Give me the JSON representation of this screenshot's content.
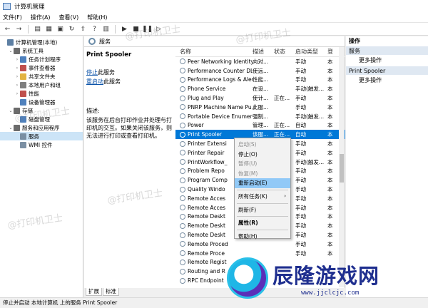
{
  "window": {
    "title": "计算机管理"
  },
  "menu": [
    "文件(F)",
    "操作(A)",
    "查看(V)",
    "帮助(H)"
  ],
  "toolbar_icons": [
    "back-arrow-icon",
    "forward-arrow-icon",
    "folder-up-icon",
    "console-tree-icon",
    "properties-icon",
    "refresh-icon",
    "export-icon",
    "help-icon",
    "show-hide-icon",
    "play-icon",
    "stop-icon",
    "pause-icon",
    "restart-icon"
  ],
  "tree": [
    {
      "label": "计算机管理(本地)",
      "level": 0,
      "tw": "",
      "icon": "#5d7fa3"
    },
    {
      "label": "系统工具",
      "level": 1,
      "tw": "⌄",
      "icon": "#6b6b6b"
    },
    {
      "label": "任务计划程序",
      "level": 2,
      "tw": "›",
      "icon": "#4f81bd"
    },
    {
      "label": "事件查看器",
      "level": 2,
      "tw": "›",
      "icon": "#c0504d"
    },
    {
      "label": "共享文件夹",
      "level": 2,
      "tw": "›",
      "icon": "#e3b341"
    },
    {
      "label": "本地用户和组",
      "level": 2,
      "tw": "›",
      "icon": "#7f7f7f"
    },
    {
      "label": "性能",
      "level": 2,
      "tw": "›",
      "icon": "#c0504d"
    },
    {
      "label": "设备管理器",
      "level": 2,
      "tw": "",
      "icon": "#4f81bd"
    },
    {
      "label": "存储",
      "level": 1,
      "tw": "⌄",
      "icon": "#6b6b6b"
    },
    {
      "label": "磁盘管理",
      "level": 2,
      "tw": "",
      "icon": "#4f81bd"
    },
    {
      "label": "服务和应用程序",
      "level": 1,
      "tw": "⌄",
      "icon": "#6b6b6b"
    },
    {
      "label": "服务",
      "level": 2,
      "tw": "",
      "icon": "#7a8fa3",
      "selected": true
    },
    {
      "label": "WMI 控件",
      "level": 2,
      "tw": "",
      "icon": "#7a8fa3"
    }
  ],
  "center": {
    "header": "服务",
    "service_name": "Print Spooler",
    "stop_link": "停止",
    "stop_suffix": "此服务",
    "restart_link": "重启动",
    "restart_suffix": "此服务",
    "desc_title": "描述:",
    "desc_text": "该服务在后台打印作业并处理与打印机的交互。如果关闭该服务，则无法进行打印或查看打印机。"
  },
  "columns": [
    "名称",
    "描述",
    "状态",
    "启动类型",
    "登"
  ],
  "services": [
    {
      "name": "Peer Networking Identity...",
      "desc": "向对...",
      "status": "",
      "start": "手动",
      "logon": "本"
    },
    {
      "name": "Performance Counter DL...",
      "desc": "使远...",
      "status": "",
      "start": "手动",
      "logon": "本"
    },
    {
      "name": "Performance Logs & Aler...",
      "desc": "性能...",
      "status": "",
      "start": "手动",
      "logon": "本"
    },
    {
      "name": "Phone Service",
      "desc": "在设...",
      "status": "",
      "start": "手动(触发...",
      "logon": "本"
    },
    {
      "name": "Plug and Play",
      "desc": "使计...",
      "status": "正在...",
      "start": "手动",
      "logon": "本"
    },
    {
      "name": "PNRP Machine Name Pu...",
      "desc": "此服...",
      "status": "",
      "start": "手动",
      "logon": "本"
    },
    {
      "name": "Portable Device Enumera...",
      "desc": "强制...",
      "status": "",
      "start": "手动(触发...",
      "logon": "本"
    },
    {
      "name": "Power",
      "desc": "管理...",
      "status": "正在...",
      "start": "自动",
      "logon": "本"
    },
    {
      "name": "Print Spooler",
      "desc": "该服...",
      "status": "正在...",
      "start": "自动",
      "logon": "本",
      "selected": true
    },
    {
      "name": "Printer Extensi",
      "desc": "",
      "status": "",
      "start": "手动",
      "logon": "本"
    },
    {
      "name": "Printer Repair",
      "desc": "",
      "status": "",
      "start": "手动",
      "logon": "本"
    },
    {
      "name": "PrintWorkflow_",
      "desc": "",
      "status": "",
      "start": "手动(触发...",
      "logon": "本"
    },
    {
      "name": "Problem Repo",
      "desc": "",
      "status": "",
      "start": "手动",
      "logon": "本"
    },
    {
      "name": "Program Comp",
      "desc": "",
      "status": "",
      "start": "手动",
      "logon": "本"
    },
    {
      "name": "Quality Windo",
      "desc": "",
      "status": "",
      "start": "手动",
      "logon": "本"
    },
    {
      "name": "Remote Acces",
      "desc": "",
      "status": "",
      "start": "手动",
      "logon": "本"
    },
    {
      "name": "Remote Acces",
      "desc": "",
      "status": "",
      "start": "手动",
      "logon": "本"
    },
    {
      "name": "Remote Deskt",
      "desc": "",
      "status": "",
      "start": "手动",
      "logon": "本"
    },
    {
      "name": "Remote Deskt",
      "desc": "",
      "status": "",
      "start": "手动",
      "logon": "本"
    },
    {
      "name": "Remote Deskt",
      "desc": "",
      "status": "",
      "start": "手动",
      "logon": "本"
    },
    {
      "name": "Remote Proced",
      "desc": "",
      "status": "",
      "start": "手动",
      "logon": "本"
    },
    {
      "name": "Remote Proce",
      "desc": "",
      "status": "",
      "start": "手动",
      "logon": "本"
    },
    {
      "name": "Remote Regist",
      "desc": "",
      "status": "",
      "start": "",
      "logon": ""
    },
    {
      "name": "Routing and R",
      "desc": "",
      "status": "",
      "start": "",
      "logon": ""
    },
    {
      "name": "RPC Endpoint",
      "desc": "",
      "status": "",
      "start": "",
      "logon": ""
    }
  ],
  "tabs": [
    "扩展",
    "标准"
  ],
  "context_menu": [
    {
      "label": "启动(S)",
      "disabled": true
    },
    {
      "label": "停止(O)"
    },
    {
      "label": "暂停(U)",
      "disabled": true
    },
    {
      "label": "恢复(M)",
      "disabled": true
    },
    {
      "label": "重新启动(E)",
      "highlight": true
    },
    {
      "sep": true
    },
    {
      "label": "所有任务(K)",
      "arrow": "›"
    },
    {
      "sep": true
    },
    {
      "label": "刷新(F)"
    },
    {
      "sep": true
    },
    {
      "label": "属性(R)",
      "bold": true
    },
    {
      "sep": true
    },
    {
      "label": "帮助(H)"
    }
  ],
  "actions": {
    "title": "操作",
    "section1": "服务",
    "section1_more": "更多操作",
    "section2": "Print Spooler",
    "section2_more": "更多操作"
  },
  "statusbar": "停止并启动 本地计算机 上的服务 Print Spooler",
  "watermarks": [
    "@打印机卫士",
    "@打印机卫士",
    "@打印机卫士",
    "@打印机卫士",
    "@打印机卫士"
  ],
  "brand": {
    "name": "辰隆游戏网",
    "url": "www.jjclcjc.com"
  },
  "colors": {
    "selection": "#0078d7",
    "menu_highlight": "#91c9f7",
    "link": "#0a52a8"
  }
}
